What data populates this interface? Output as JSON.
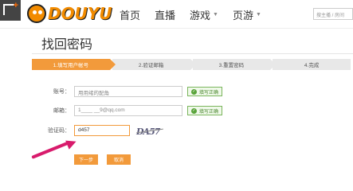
{
  "header": {
    "logo_text": "DOUYU",
    "nav": [
      {
        "label": "首页",
        "has_dropdown": false
      },
      {
        "label": "直播",
        "has_dropdown": false
      },
      {
        "label": "游戏",
        "has_dropdown": true
      },
      {
        "label": "页游",
        "has_dropdown": true
      }
    ],
    "search_placeholder": "搜主播 / 房间",
    "dropdown_arrow": "▼"
  },
  "page": {
    "title": "找回密码"
  },
  "steps": [
    {
      "label": "1.填写用户帐号",
      "active": true
    },
    {
      "label": "2.验证邮箱",
      "active": false
    },
    {
      "label": "3.重置密码",
      "active": false
    },
    {
      "label": "4.完成",
      "active": false
    }
  ],
  "form": {
    "account": {
      "label": "账号：",
      "value": "用用绪的配角",
      "status": "填写正确"
    },
    "email": {
      "label": "邮箱：",
      "value": "1____ __9@qq.com",
      "status": "填写正确"
    },
    "captcha": {
      "label": "验证码：",
      "value": "d457",
      "image_text": "DA57"
    }
  },
  "buttons": {
    "next": "下一步",
    "cancel": "取消"
  },
  "icons": {
    "check": "✓",
    "corner_plus": "+"
  },
  "colors": {
    "accent": "#f29a3b",
    "brand": "#f28b00",
    "success": "#59a43a",
    "annotation": "#d81b6c"
  }
}
